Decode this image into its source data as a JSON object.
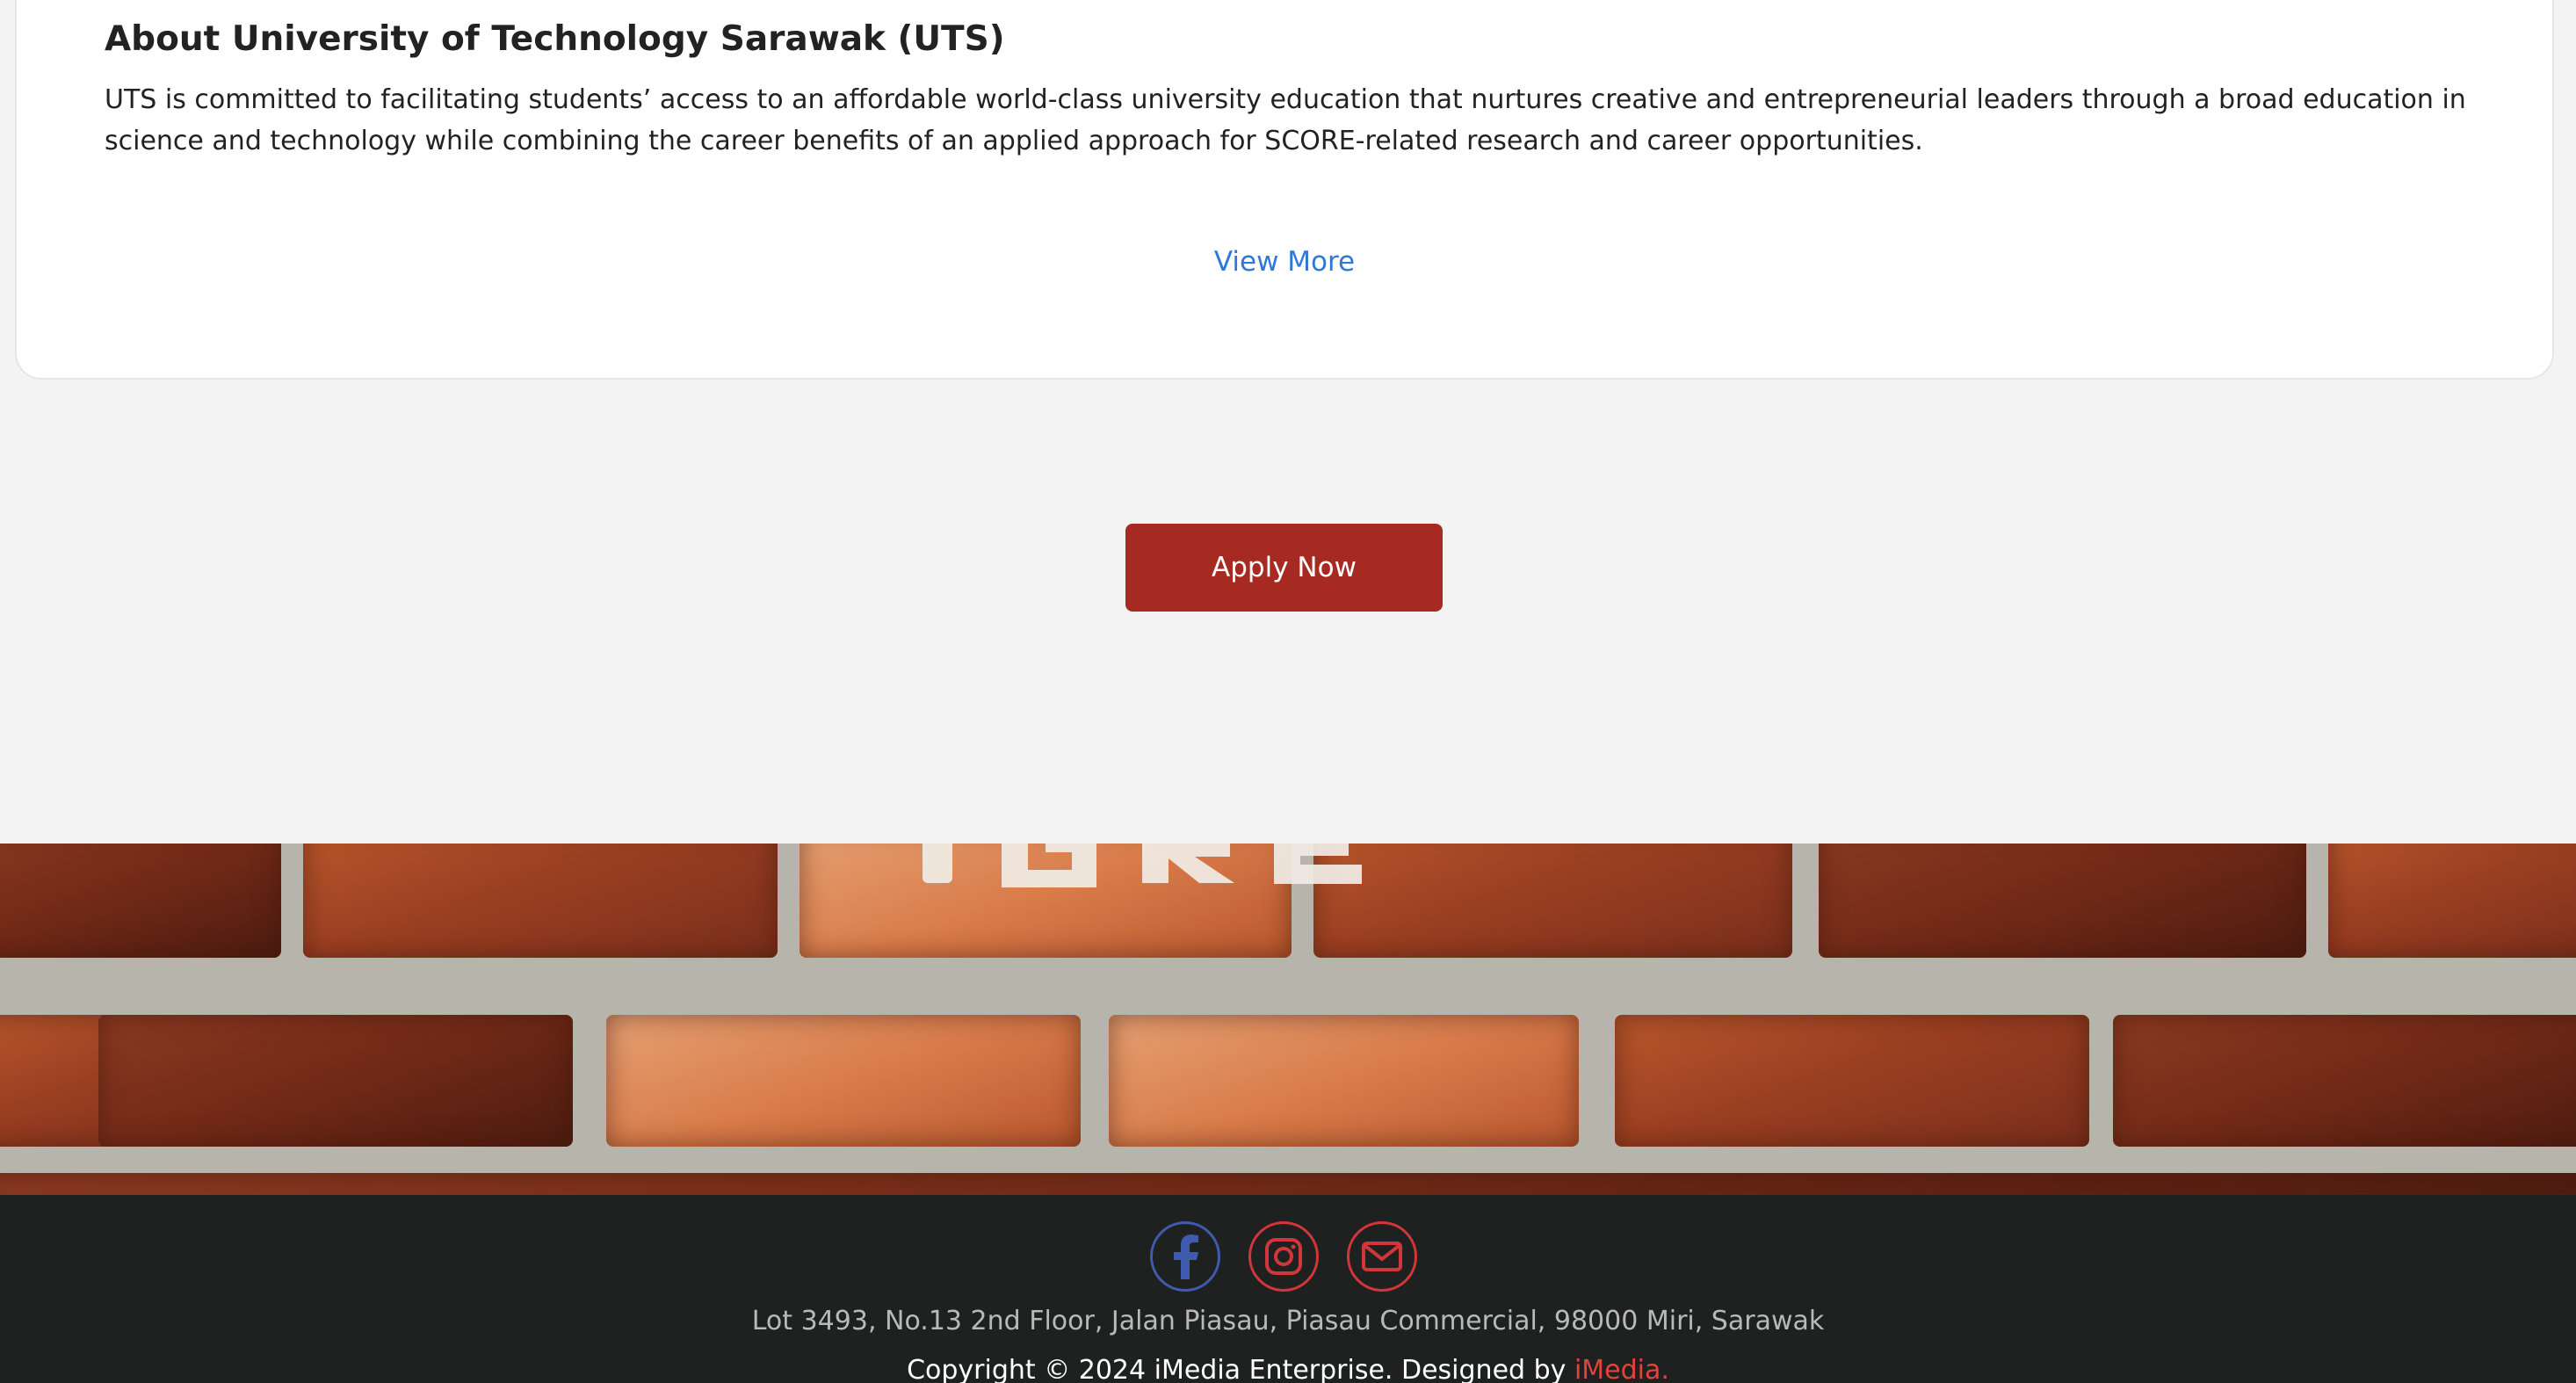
{
  "about": {
    "title": "About University of Technology Sarawak (UTS)",
    "description": "UTS is committed to facilitating students’ access to an affordable world-class university education that nurtures creative and entrepreneurial leaders through a broad education in science and technology while combining the career benefits of an applied approach for SCORE-related research and career opportunities.",
    "view_more_label": "View More"
  },
  "apply": {
    "label": "Apply Now"
  },
  "footer": {
    "social": [
      {
        "name": "facebook-icon",
        "color": "#3f5bb0"
      },
      {
        "name": "instagram-icon",
        "color": "#d2363a"
      },
      {
        "name": "email-icon",
        "color": "#d2363a"
      }
    ],
    "address": "Lot 3493, No.13 2nd Floor, Jalan Piasau, Piasau Commercial, 98000 Miri, Sarawak",
    "copyright_prefix": "Copyright © 2024 iMedia Enterprise. Designed by ",
    "designer": "iMedia."
  },
  "colors": {
    "accent": "#a72a22",
    "link": "#2f78d6",
    "footer_bg": "#1f2120"
  }
}
